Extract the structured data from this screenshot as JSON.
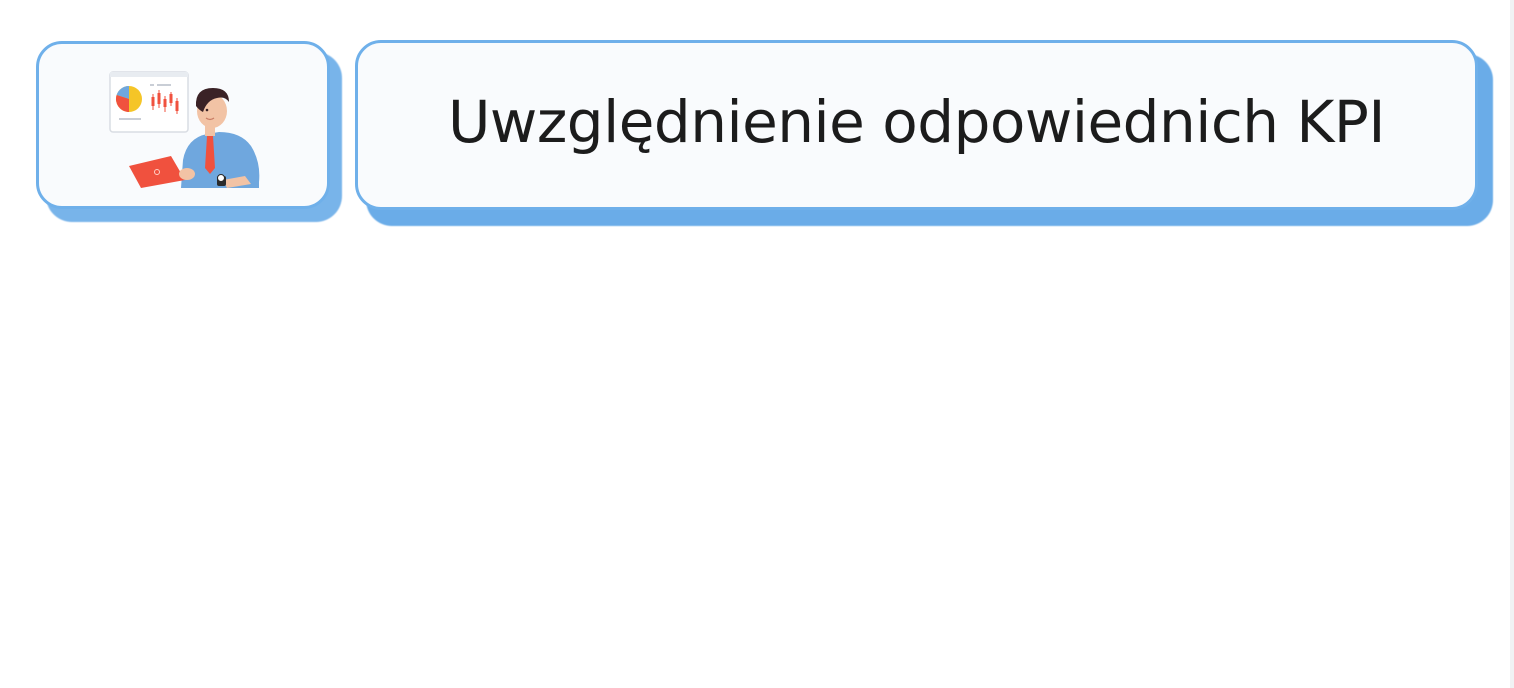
{
  "slide": {
    "title": "Uwzględnienie odpowiednich KPI",
    "illustration": "person-presenting-dashboard-icon"
  },
  "colors": {
    "card_border": "#6fb0ea",
    "card_shadow": "#6aace8",
    "card_fill": "#f9fbfd",
    "title_text": "#1c1c1c",
    "accent_red": "#f0513e",
    "accent_yellow": "#f5c527",
    "shirt_blue": "#6fa7de"
  }
}
